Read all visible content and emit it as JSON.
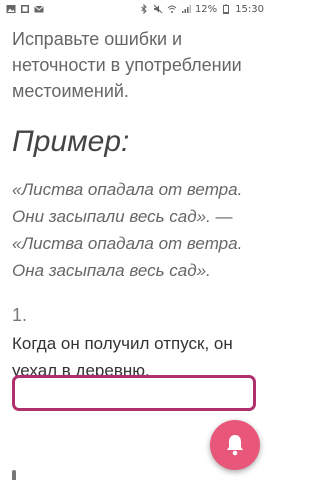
{
  "status_bar": {
    "battery_percent": "12%",
    "time": "15:30"
  },
  "lesson": {
    "instruction": "Исправьте ошибки и неточности в употреблении местоимений.",
    "example_heading": "Пример:",
    "example_line1": "«Листва опадала от ветра.",
    "example_line2": "Они засыпали весь сад». —",
    "example_line3": "«Листва опадала от ветра.",
    "example_line4": "Она засыпала весь сад».",
    "question_number": "1.",
    "question_text": "Когда он получил отпуск, он уехал в деревню.",
    "answer_value": ""
  },
  "colors": {
    "accent": "#b0306e",
    "fab": "#e8567a"
  },
  "icons": {
    "fab": "bell-icon"
  }
}
